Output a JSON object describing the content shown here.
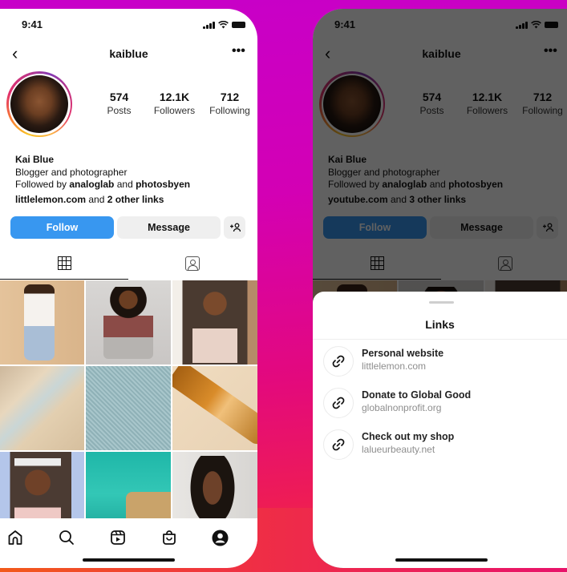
{
  "left_phone": {
    "status": {
      "time": "9:41"
    },
    "nav": {
      "back_glyph": "‹",
      "username": "kaiblue",
      "more_glyph": "•••"
    },
    "stats": [
      {
        "value": "574",
        "label": "Posts"
      },
      {
        "value": "12.1K",
        "label": "Followers"
      },
      {
        "value": "712",
        "label": "Following"
      }
    ],
    "bio": {
      "name": "Kai Blue",
      "description": "Blogger and photographer",
      "followed_prefix": "Followed by ",
      "followed_user1": "analoglab",
      "followed_mid": " and ",
      "followed_user2": "photosbyen",
      "link_main": "littlelemon.com",
      "link_mid": " and ",
      "link_more": "2 other links"
    },
    "actions": {
      "follow": "Follow",
      "message": "Message",
      "suggest_glyph": "+👤"
    },
    "tabs": [
      "grid-icon",
      "tagged-icon"
    ],
    "grid_photos": [
      "woman-in-white-blazer",
      "woman-cooking",
      "woman-smiling-selfie",
      "sand-dunes-aerial",
      "beach-umbrellas-aerial",
      "serum-bottles",
      "woman-headband",
      "turquoise-sea-city",
      "woman-portrait"
    ],
    "tabbar": [
      "home-icon",
      "search-icon",
      "reels-icon",
      "shop-icon",
      "profile-icon"
    ]
  },
  "right_phone": {
    "status": {
      "time": "9:41"
    },
    "nav": {
      "back_glyph": "‹",
      "username": "kaiblue",
      "more_glyph": "•••"
    },
    "stats": [
      {
        "value": "574",
        "label": "Posts"
      },
      {
        "value": "12.1K",
        "label": "Followers"
      },
      {
        "value": "712",
        "label": "Following"
      }
    ],
    "bio": {
      "name": "Kai Blue",
      "description": "Blogger and photographer",
      "followed_prefix": "Followed by ",
      "followed_user1": "analoglab",
      "followed_mid": " and ",
      "followed_user2": "photosbyen",
      "link_main": "youtube.com",
      "link_mid": " and ",
      "link_more": "3 other links"
    },
    "actions": {
      "follow": "Follow",
      "message": "Message"
    },
    "links_sheet": {
      "title": "Links",
      "items": [
        {
          "title": "Personal website",
          "url": "littlelemon.com"
        },
        {
          "title": "Donate to Global Good",
          "url": "globalnonprofit.org"
        },
        {
          "title": "Check out my shop",
          "url": "lalueurbeauty.net"
        }
      ]
    }
  },
  "colors": {
    "follow_blue": "#3897f0",
    "background_top": "#c700c9",
    "background_bottom": "#f2402f"
  }
}
